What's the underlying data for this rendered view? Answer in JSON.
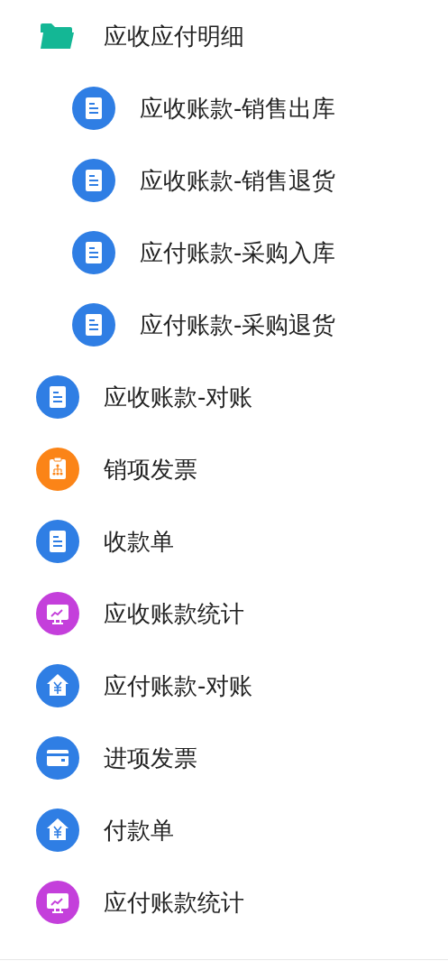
{
  "menu": [
    {
      "label": "应收应付明细",
      "kind": "folder",
      "expanded": true,
      "children": [
        {
          "label": "应收账款-销售出库",
          "kind": "document"
        },
        {
          "label": "应收账款-销售退货",
          "kind": "document"
        },
        {
          "label": "应付账款-采购入库",
          "kind": "document"
        },
        {
          "label": "应付账款-采购退货",
          "kind": "document"
        }
      ]
    },
    {
      "label": "应收账款-对账",
      "kind": "document"
    },
    {
      "label": "销项发票",
      "kind": "chart-board"
    },
    {
      "label": "收款单",
      "kind": "document"
    },
    {
      "label": "应收账款统计",
      "kind": "monitor"
    },
    {
      "label": "应付账款-对账",
      "kind": "house"
    },
    {
      "label": "进项发票",
      "kind": "card"
    },
    {
      "label": "付款单",
      "kind": "house"
    },
    {
      "label": "应付账款统计",
      "kind": "monitor"
    }
  ]
}
